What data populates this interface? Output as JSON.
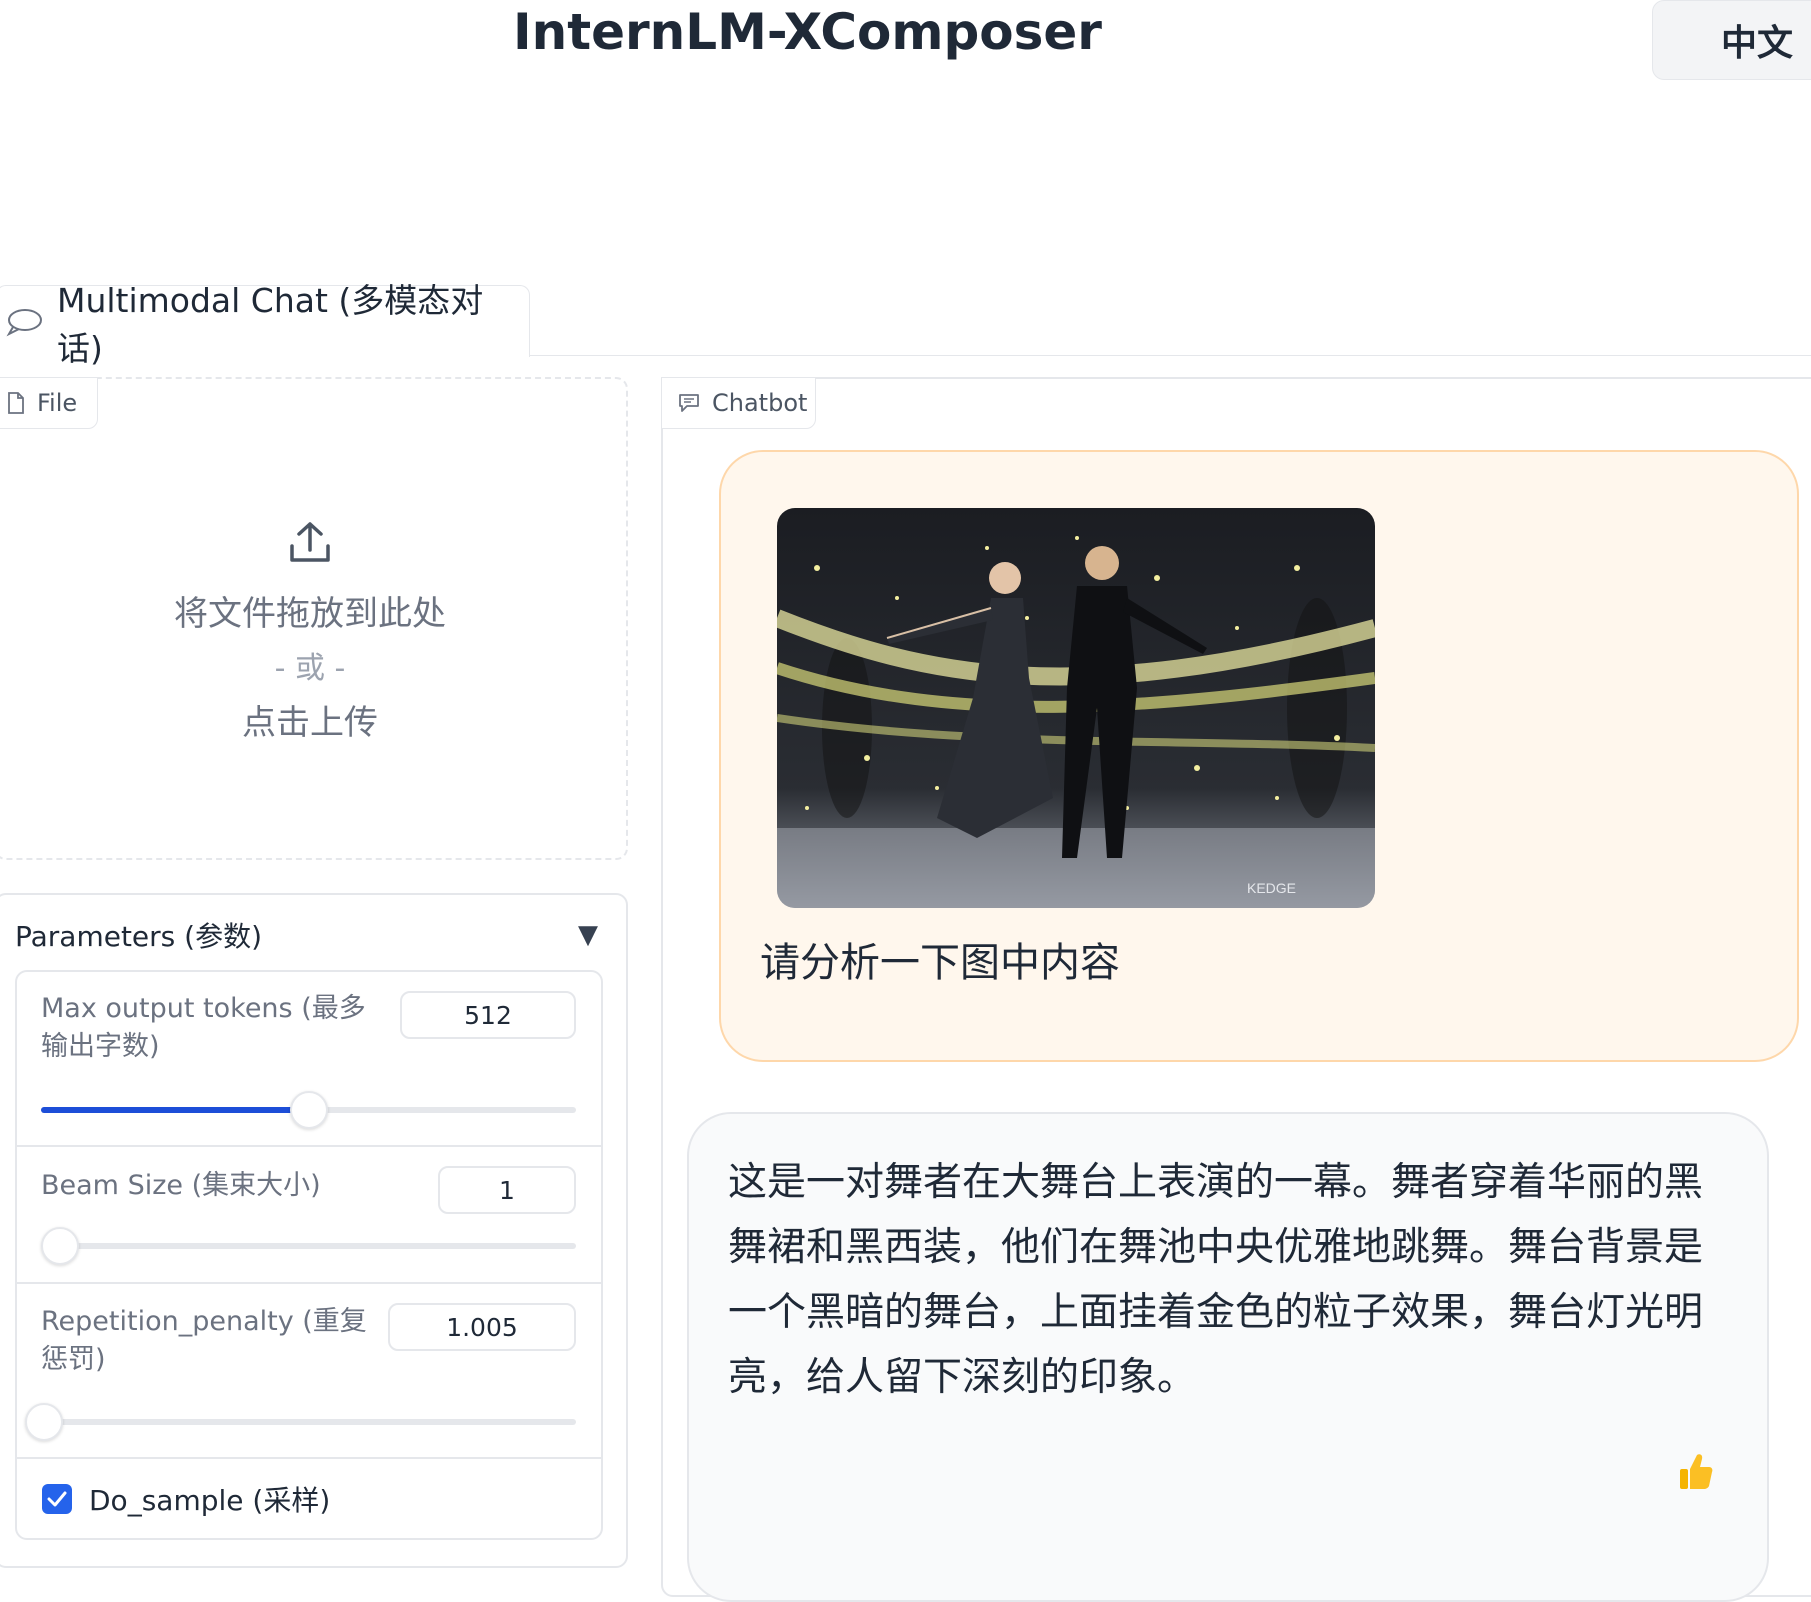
{
  "header": {
    "title": "InternLM-XComposer",
    "lang_button": "中文"
  },
  "tabs": [
    {
      "label": "Multimodal Chat (多模态对话)",
      "active": true
    }
  ],
  "file_panel": {
    "label": "File",
    "drop_text": "将文件拖放到此处",
    "or_text": "- 或 -",
    "click_text": "点击上传"
  },
  "parameters": {
    "title": "Parameters (参数)",
    "max_tokens": {
      "label": "Max output tokens (最多输出字数)",
      "value": "512",
      "fraction": 0.5
    },
    "beam_size": {
      "label": "Beam Size (集束大小)",
      "value": "1",
      "fraction": 0.0
    },
    "repetition_penalty": {
      "label": "Repetition_penalty (重复惩罚)",
      "value": "1.005",
      "fraction": 0.005
    },
    "do_sample": {
      "label": "Do_sample (采样)",
      "checked": true
    }
  },
  "chatbot": {
    "label": "Chatbot",
    "user_message": "请分析一下图中内容",
    "image_watermark": "KEDGE",
    "bot_message": "这是一对舞者在大舞台上表演的一幕。舞者穿着华丽的黑舞裙和黑西装，他们在舞池中央优雅地跳舞。舞台背景是一个黑暗的舞台，上面挂着金色的粒子效果，舞台灯光明亮，给人留下深刻的印象。"
  },
  "colors": {
    "accent": "#2563eb",
    "user_bubble": "#fff7ed",
    "user_border": "#fed7aa",
    "bot_bubble": "#f9fafb"
  }
}
